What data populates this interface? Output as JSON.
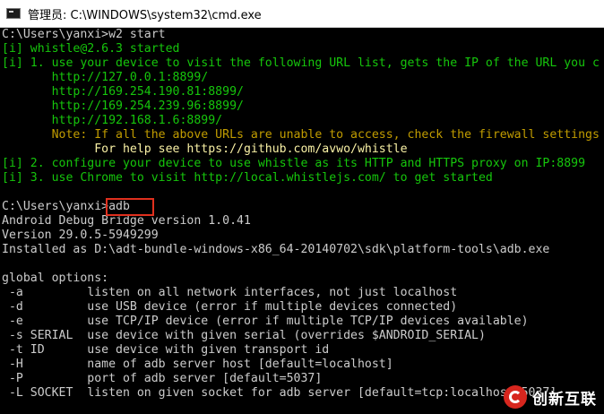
{
  "window": {
    "title": "管理员: C:\\WINDOWS\\system32\\cmd.exe",
    "icon": "cmd-icon"
  },
  "console_lines": [
    {
      "color": "c-default",
      "text": "C:\\Users\\yanxi>w2 start"
    },
    {
      "color": "c-green",
      "text": "[i] whistle@2.6.3 started"
    },
    {
      "color": "c-green",
      "text": "[i] 1. use your device to visit the following URL list, gets the IP of the URL you c"
    },
    {
      "color": "c-green",
      "text": "       http://127.0.0.1:8899/"
    },
    {
      "color": "c-green",
      "text": "       http://169.254.190.81:8899/"
    },
    {
      "color": "c-green",
      "text": "       http://169.254.239.96:8899/"
    },
    {
      "color": "c-green",
      "text": "       http://192.168.1.6:8899/"
    },
    {
      "color": "c-yellow2",
      "text": "       Note: If all the above URLs are unable to access, check the firewall settings"
    },
    {
      "color": "c-yellow",
      "text": "             For help see https://github.com/avwo/whistle"
    },
    {
      "color": "c-green",
      "text": "[i] 2. configure your device to use whistle as its HTTP and HTTPS proxy on IP:8899"
    },
    {
      "color": "c-green",
      "text": "[i] 3. use Chrome to visit http://local.whistlejs.com/ to get started"
    },
    {
      "color": "c-default",
      "text": ""
    },
    {
      "color": "c-default",
      "text": "C:\\Users\\yanxi>adb"
    },
    {
      "color": "c-default",
      "text": "Android Debug Bridge version 1.0.41"
    },
    {
      "color": "c-default",
      "text": "Version 29.0.5-5949299"
    },
    {
      "color": "c-default",
      "text": "Installed as D:\\adt-bundle-windows-x86_64-20140702\\sdk\\platform-tools\\adb.exe"
    },
    {
      "color": "c-default",
      "text": ""
    },
    {
      "color": "c-default",
      "text": "global options:"
    },
    {
      "color": "c-default",
      "text": " -a         listen on all network interfaces, not just localhost"
    },
    {
      "color": "c-default",
      "text": " -d         use USB device (error if multiple devices connected)"
    },
    {
      "color": "c-default",
      "text": " -e         use TCP/IP device (error if multiple TCP/IP devices available)"
    },
    {
      "color": "c-default",
      "text": " -s SERIAL  use device with given serial (overrides $ANDROID_SERIAL)"
    },
    {
      "color": "c-default",
      "text": " -t ID      use device with given transport id"
    },
    {
      "color": "c-default",
      "text": " -H         name of adb server host [default=localhost]"
    },
    {
      "color": "c-default",
      "text": " -P         port of adb server [default=5037]"
    },
    {
      "color": "c-default",
      "text": " -L SOCKET  listen on given socket for adb server [default=tcp:localhost:5037]"
    }
  ],
  "watermark": {
    "text": "创新互联",
    "icon": "logo-icon"
  },
  "colors": {
    "highlight_box": "#e0301e",
    "console_bg": "#000000",
    "green": "#16c60c",
    "yellow": "#c19c00"
  }
}
